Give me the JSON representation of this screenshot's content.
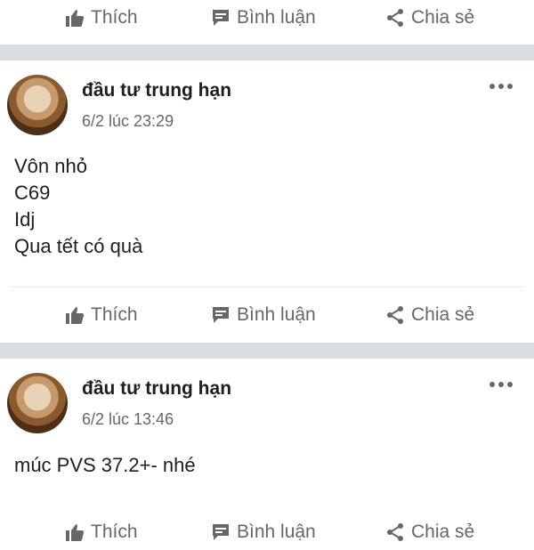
{
  "actions": {
    "like": "Thích",
    "comment": "Bình luận",
    "share": "Chia sẻ"
  },
  "posts": [
    {
      "author": "đầu tư trung hạn",
      "time": "6/2 lúc 23:29",
      "lines": [
        "Vôn nhỏ",
        "C69",
        "Idj",
        "Qua tết có quà"
      ]
    },
    {
      "author": "đầu tư trung hạn",
      "time": "6/2 lúc 13:46",
      "lines": [
        "múc PVS 37.2+- nhé"
      ]
    }
  ],
  "icons": {
    "like": "thumbs-up-icon",
    "comment": "comment-icon",
    "share": "share-icon",
    "more": "more-dots-icon"
  },
  "colors": {
    "muted": "#65676b",
    "separator": "#dadde1"
  }
}
